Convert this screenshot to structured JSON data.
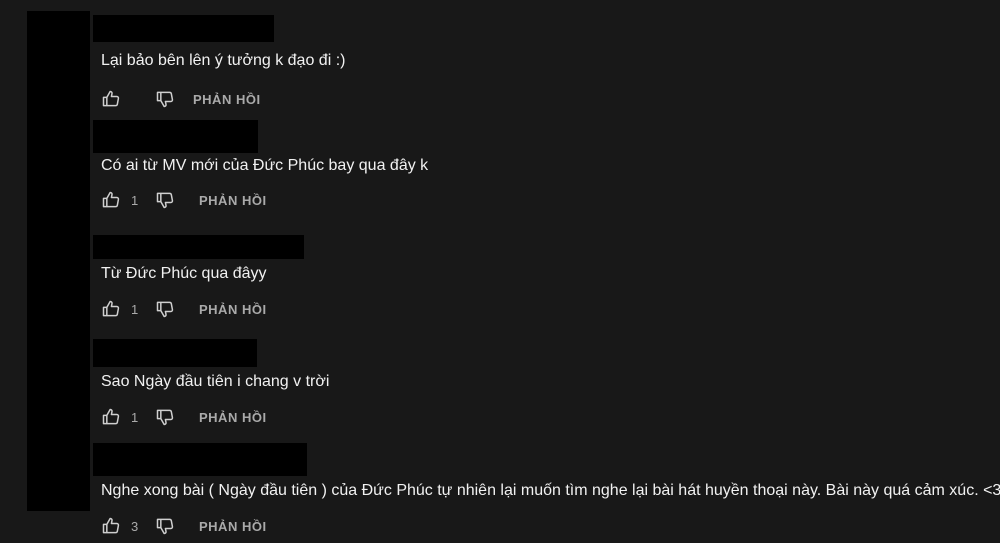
{
  "reply_label": "PHẢN HỒI",
  "comments": [
    {
      "text": "Lại bảo bên lên ý tưởng k đạo đi :)",
      "likes": ""
    },
    {
      "text": "Có ai từ MV mới của Đức Phúc bay qua đây k",
      "likes": "1"
    },
    {
      "text": "Từ Đức Phúc qua đâyy",
      "likes": "1"
    },
    {
      "text": "Sao Ngày đầu tiên i chang v trời",
      "likes": "1"
    },
    {
      "text": "Nghe xong bài ( Ngày đầu tiên ) của Đức Phúc tự nhiên lại muốn tìm nghe lại bài hát huyền thoại này. Bài này quá cảm xúc. <3",
      "likes": "3"
    }
  ],
  "icons": {
    "like": "thumbs-up-icon",
    "dislike": "thumbs-down-icon"
  }
}
